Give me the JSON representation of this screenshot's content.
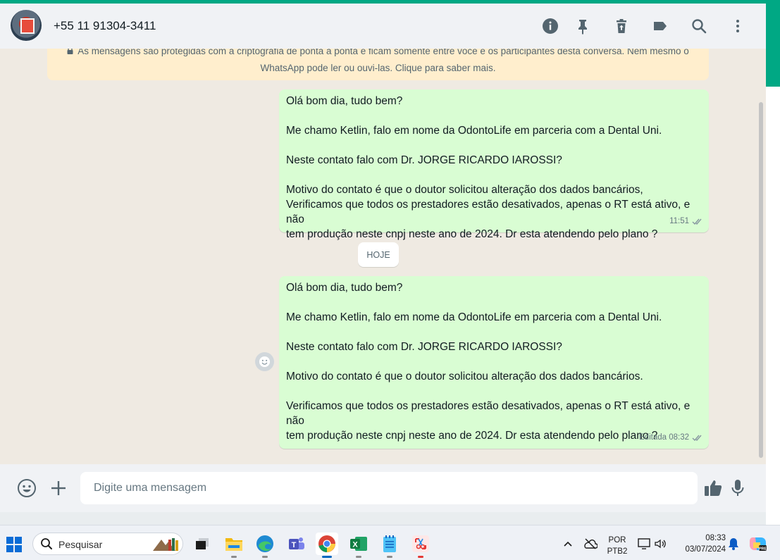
{
  "header": {
    "contact_name": "+55 11 91304-3411"
  },
  "encryption_notice": {
    "line1": "As mensagens são protegidas com a criptografia de ponta a ponta e ficam somente entre você e os participantes desta conversa. Nem mesmo o",
    "line2": "WhatsApp pode ler ou ouvi-las. Clique para saber mais."
  },
  "messages": [
    {
      "p1": "Olá bom dia, tudo bem?",
      "p2": "Me chamo Ketlin, falo em nome da OdontoLife em parceria com a Dental Uni.",
      "p3": "Neste contato falo com Dr. JORGE RICARDO IAROSSI?",
      "p4": "Motivo do contato é que o doutor solicitou alteração dos dados bancários,\nVerificamos que todos os prestadores estão desativados, apenas o RT está ativo, e não\ntem produção neste cnpj neste ano de 2024. Dr esta atendendo pelo plano ?",
      "time": "11:51"
    },
    {
      "p1": "Olá bom dia, tudo bem?",
      "p2": "Me chamo Ketlin, falo em nome da OdontoLife em parceria com a Dental Uni.",
      "p3": "Neste contato falo com Dr. JORGE RICARDO IAROSSI?",
      "p4": "Motivo do contato é que o doutor solicitou alteração dos dados bancários.",
      "p5": "Verificamos que todos os prestadores estão desativados, apenas o RT está ativo, e não\ntem produção neste cnpj neste ano de 2024. Dr esta atendendo pelo plano ?",
      "time": "Editada 08:32"
    }
  ],
  "day_chip": "HOJE",
  "composer": {
    "placeholder": "Digite uma mensagem"
  },
  "taskbar": {
    "search_label": "Pesquisar",
    "lang_line1": "POR",
    "lang_line2": "PTB2",
    "time": "08:33",
    "date": "03/07/2024"
  },
  "colors": {
    "accent": "#00a884",
    "outgoing_bubble": "#d9fdd3",
    "chat_background": "#efeae2",
    "notice_background": "#ffeecd"
  },
  "icons": [
    "info-icon",
    "pin-icon",
    "trash-icon",
    "label-icon",
    "search-icon",
    "more-vertical-icon",
    "emoji-icon",
    "plus-icon",
    "thumbs-up-icon",
    "mic-icon",
    "double-check-icon"
  ]
}
